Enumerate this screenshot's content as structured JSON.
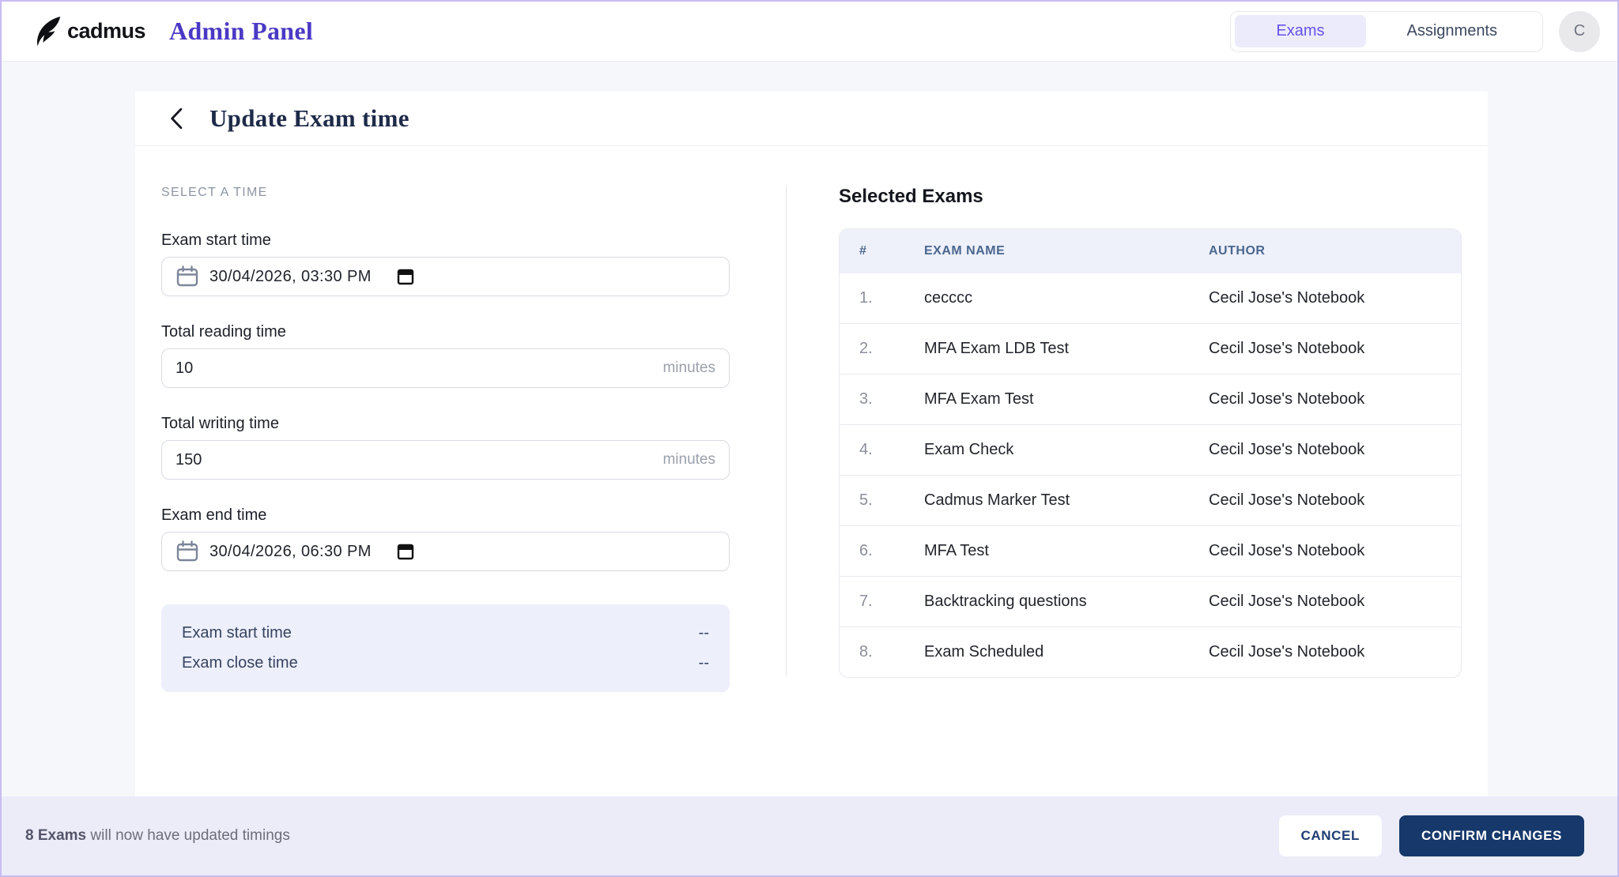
{
  "navbar": {
    "logo_text": "cadmus",
    "logo_icon": "feather-icon",
    "app_title": "Admin Panel",
    "tabs": [
      {
        "label": "Exams",
        "active": true
      },
      {
        "label": "Assignments",
        "active": false
      }
    ],
    "avatar_initial": "C"
  },
  "page": {
    "back_icon": "chevron-left-icon",
    "title": "Update Exam time"
  },
  "form": {
    "section_label": "SELECT A TIME",
    "exam_start": {
      "label": "Exam start time",
      "value": "30/04/2026, 03:30 PM",
      "icon": "calendar-icon",
      "picker_icon": "calendar-picker-icon"
    },
    "reading": {
      "label": "Total reading time",
      "value": "10",
      "suffix": "minutes"
    },
    "writing": {
      "label": "Total writing time",
      "value": "150",
      "suffix": "minutes"
    },
    "exam_end": {
      "label": "Exam end time",
      "value": "30/04/2026, 06:30 PM",
      "icon": "calendar-icon",
      "picker_icon": "calendar-picker-icon"
    },
    "summary": {
      "rows": [
        {
          "label": "Exam start time",
          "value": "--"
        },
        {
          "label": "Exam close time",
          "value": "--"
        }
      ]
    }
  },
  "selected_exams": {
    "title": "Selected Exams",
    "columns": {
      "num": "#",
      "name": "EXAM NAME",
      "author": "AUTHOR"
    },
    "rows": [
      {
        "num": "1.",
        "name": "cecccc",
        "author": "Cecil Jose's Notebook"
      },
      {
        "num": "2.",
        "name": "MFA Exam LDB Test",
        "author": "Cecil Jose's Notebook"
      },
      {
        "num": "3.",
        "name": "MFA Exam Test",
        "author": "Cecil Jose's Notebook"
      },
      {
        "num": "4.",
        "name": "Exam Check",
        "author": "Cecil Jose's Notebook"
      },
      {
        "num": "5.",
        "name": "Cadmus Marker Test",
        "author": "Cecil Jose's Notebook"
      },
      {
        "num": "6.",
        "name": "MFA Test",
        "author": "Cecil Jose's Notebook"
      },
      {
        "num": "7.",
        "name": "Backtracking questions",
        "author": "Cecil Jose's Notebook"
      },
      {
        "num": "8.",
        "name": "Exam Scheduled",
        "author": "Cecil Jose's Notebook"
      }
    ]
  },
  "footer": {
    "count_bold": "8 Exams",
    "message_rest": " will now have updated timings",
    "cancel_label": "CANCEL",
    "confirm_label": "CONFIRM CHANGES"
  },
  "colors": {
    "brand_purple": "#4a39c4",
    "tab_active_text": "#6552ea",
    "tab_active_bg": "#ecebfc",
    "navy_button": "#16386b",
    "table_header_text": "#49678f",
    "table_header_bg": "#eef0fa",
    "summary_bg": "#edeffb",
    "footer_bg": "#ebecf8",
    "page_bg": "#f6f7fa",
    "outer_border": "#c9bcf2"
  }
}
